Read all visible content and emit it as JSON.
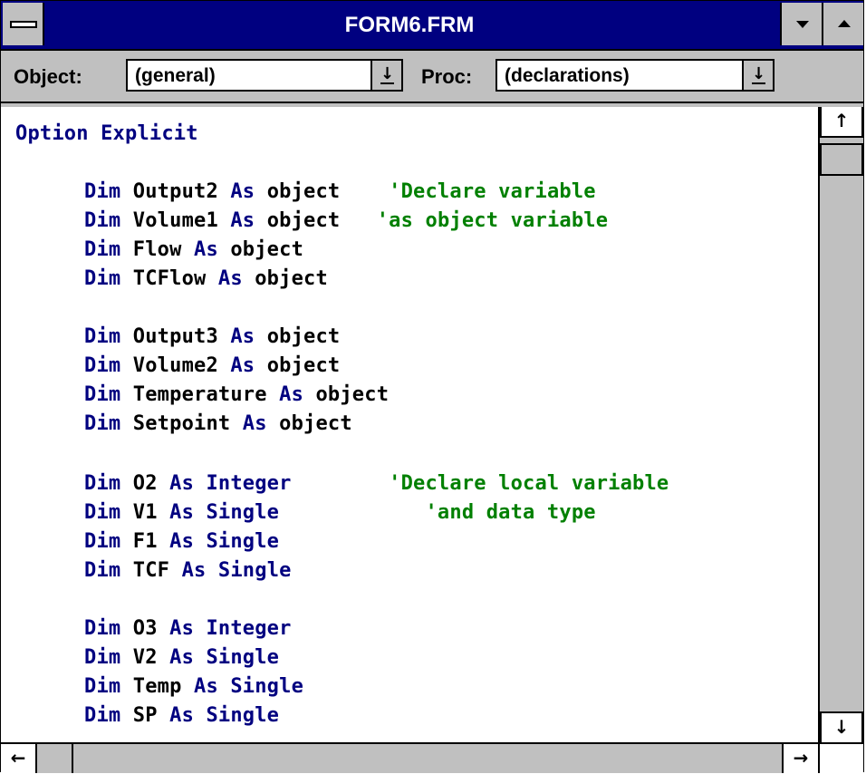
{
  "window": {
    "title": "FORM6.FRM"
  },
  "toolbar": {
    "object_label": "Object:",
    "object_value": "(general)",
    "proc_label": "Proc:",
    "proc_value": "(declarations)"
  },
  "icons": {
    "system_menu": "system-menu-icon",
    "minimize": "minimize-icon",
    "maximize": "maximize-icon",
    "dropdown": "dropdown-arrow-icon",
    "scroll_up": "scroll-up-arrow-icon",
    "scroll_down": "scroll-down-arrow-icon",
    "scroll_left": "scroll-left-arrow-icon",
    "scroll_right": "scroll-right-arrow-icon"
  },
  "colors": {
    "title_bar": "#000080",
    "keyword": "#000080",
    "identifier": "#000000",
    "comment": "#008000",
    "chrome": "#c0c0c0"
  },
  "code": {
    "l1": {
      "kw": "Option Explicit"
    },
    "l2": {
      "kw1": "Dim",
      "id1": " Output2 ",
      "kw2": "As",
      "id2": " object",
      "gap": "    ",
      "cm": "'Declare variable"
    },
    "l3": {
      "kw1": "Dim",
      "id1": " Volume1 ",
      "kw2": "As",
      "id2": " object",
      "gap": "   ",
      "cm": "'as object variable"
    },
    "l4": {
      "kw1": "Dim",
      "id1": " Flow ",
      "kw2": "As",
      "id2": " object"
    },
    "l5": {
      "kw1": "Dim",
      "id1": " TCFlow ",
      "kw2": "As",
      "id2": " object"
    },
    "l6": {
      "kw1": "Dim",
      "id1": " Output3 ",
      "kw2": "As",
      "id2": " object"
    },
    "l7": {
      "kw1": "Dim",
      "id1": " Volume2 ",
      "kw2": "As",
      "id2": " object"
    },
    "l8": {
      "kw1": "Dim",
      "id1": " Temperature ",
      "kw2": "As",
      "id2": " object"
    },
    "l9": {
      "kw1": "Dim",
      "id1": " Setpoint ",
      "kw2": "As",
      "id2": " object"
    },
    "l10": {
      "kw1": "Dim",
      "id1": " O2 ",
      "kw2": "As Integer",
      "gap": "        ",
      "cm": "'Declare local variable"
    },
    "l11": {
      "kw1": "Dim",
      "id1": " V1 ",
      "kw2": "As Single",
      "gap": "            ",
      "cm": "'and data type"
    },
    "l12": {
      "kw1": "Dim",
      "id1": " F1 ",
      "kw2": "As Single"
    },
    "l13": {
      "kw1": "Dim",
      "id1": " TCF ",
      "kw2": "As Single"
    },
    "l14": {
      "kw1": "Dim",
      "id1": " O3 ",
      "kw2": "As Integer"
    },
    "l15": {
      "kw1": "Dim",
      "id1": " V2 ",
      "kw2": "As Single"
    },
    "l16": {
      "kw1": "Dim",
      "id1": " Temp ",
      "kw2": "As Single"
    },
    "l17": {
      "kw1": "Dim",
      "id1": " SP ",
      "kw2": "As Single"
    }
  }
}
